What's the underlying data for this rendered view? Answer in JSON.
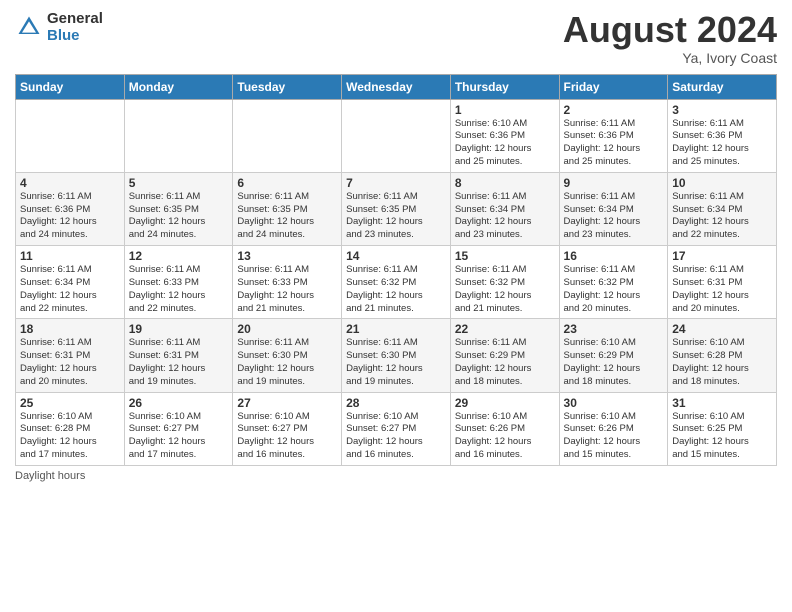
{
  "logo": {
    "general": "General",
    "blue": "Blue"
  },
  "header": {
    "month_year": "August 2024",
    "location": "Ya, Ivory Coast"
  },
  "footer": {
    "note": "Daylight hours"
  },
  "days_of_week": [
    "Sunday",
    "Monday",
    "Tuesday",
    "Wednesday",
    "Thursday",
    "Friday",
    "Saturday"
  ],
  "weeks": [
    {
      "days": [
        {
          "num": "",
          "info": ""
        },
        {
          "num": "",
          "info": ""
        },
        {
          "num": "",
          "info": ""
        },
        {
          "num": "",
          "info": ""
        },
        {
          "num": "1",
          "info": "Sunrise: 6:10 AM\nSunset: 6:36 PM\nDaylight: 12 hours\nand 25 minutes."
        },
        {
          "num": "2",
          "info": "Sunrise: 6:11 AM\nSunset: 6:36 PM\nDaylight: 12 hours\nand 25 minutes."
        },
        {
          "num": "3",
          "info": "Sunrise: 6:11 AM\nSunset: 6:36 PM\nDaylight: 12 hours\nand 25 minutes."
        }
      ]
    },
    {
      "days": [
        {
          "num": "4",
          "info": "Sunrise: 6:11 AM\nSunset: 6:36 PM\nDaylight: 12 hours\nand 24 minutes."
        },
        {
          "num": "5",
          "info": "Sunrise: 6:11 AM\nSunset: 6:35 PM\nDaylight: 12 hours\nand 24 minutes."
        },
        {
          "num": "6",
          "info": "Sunrise: 6:11 AM\nSunset: 6:35 PM\nDaylight: 12 hours\nand 24 minutes."
        },
        {
          "num": "7",
          "info": "Sunrise: 6:11 AM\nSunset: 6:35 PM\nDaylight: 12 hours\nand 23 minutes."
        },
        {
          "num": "8",
          "info": "Sunrise: 6:11 AM\nSunset: 6:34 PM\nDaylight: 12 hours\nand 23 minutes."
        },
        {
          "num": "9",
          "info": "Sunrise: 6:11 AM\nSunset: 6:34 PM\nDaylight: 12 hours\nand 23 minutes."
        },
        {
          "num": "10",
          "info": "Sunrise: 6:11 AM\nSunset: 6:34 PM\nDaylight: 12 hours\nand 22 minutes."
        }
      ]
    },
    {
      "days": [
        {
          "num": "11",
          "info": "Sunrise: 6:11 AM\nSunset: 6:34 PM\nDaylight: 12 hours\nand 22 minutes."
        },
        {
          "num": "12",
          "info": "Sunrise: 6:11 AM\nSunset: 6:33 PM\nDaylight: 12 hours\nand 22 minutes."
        },
        {
          "num": "13",
          "info": "Sunrise: 6:11 AM\nSunset: 6:33 PM\nDaylight: 12 hours\nand 21 minutes."
        },
        {
          "num": "14",
          "info": "Sunrise: 6:11 AM\nSunset: 6:32 PM\nDaylight: 12 hours\nand 21 minutes."
        },
        {
          "num": "15",
          "info": "Sunrise: 6:11 AM\nSunset: 6:32 PM\nDaylight: 12 hours\nand 21 minutes."
        },
        {
          "num": "16",
          "info": "Sunrise: 6:11 AM\nSunset: 6:32 PM\nDaylight: 12 hours\nand 20 minutes."
        },
        {
          "num": "17",
          "info": "Sunrise: 6:11 AM\nSunset: 6:31 PM\nDaylight: 12 hours\nand 20 minutes."
        }
      ]
    },
    {
      "days": [
        {
          "num": "18",
          "info": "Sunrise: 6:11 AM\nSunset: 6:31 PM\nDaylight: 12 hours\nand 20 minutes."
        },
        {
          "num": "19",
          "info": "Sunrise: 6:11 AM\nSunset: 6:31 PM\nDaylight: 12 hours\nand 19 minutes."
        },
        {
          "num": "20",
          "info": "Sunrise: 6:11 AM\nSunset: 6:30 PM\nDaylight: 12 hours\nand 19 minutes."
        },
        {
          "num": "21",
          "info": "Sunrise: 6:11 AM\nSunset: 6:30 PM\nDaylight: 12 hours\nand 19 minutes."
        },
        {
          "num": "22",
          "info": "Sunrise: 6:11 AM\nSunset: 6:29 PM\nDaylight: 12 hours\nand 18 minutes."
        },
        {
          "num": "23",
          "info": "Sunrise: 6:10 AM\nSunset: 6:29 PM\nDaylight: 12 hours\nand 18 minutes."
        },
        {
          "num": "24",
          "info": "Sunrise: 6:10 AM\nSunset: 6:28 PM\nDaylight: 12 hours\nand 18 minutes."
        }
      ]
    },
    {
      "days": [
        {
          "num": "25",
          "info": "Sunrise: 6:10 AM\nSunset: 6:28 PM\nDaylight: 12 hours\nand 17 minutes."
        },
        {
          "num": "26",
          "info": "Sunrise: 6:10 AM\nSunset: 6:27 PM\nDaylight: 12 hours\nand 17 minutes."
        },
        {
          "num": "27",
          "info": "Sunrise: 6:10 AM\nSunset: 6:27 PM\nDaylight: 12 hours\nand 16 minutes."
        },
        {
          "num": "28",
          "info": "Sunrise: 6:10 AM\nSunset: 6:27 PM\nDaylight: 12 hours\nand 16 minutes."
        },
        {
          "num": "29",
          "info": "Sunrise: 6:10 AM\nSunset: 6:26 PM\nDaylight: 12 hours\nand 16 minutes."
        },
        {
          "num": "30",
          "info": "Sunrise: 6:10 AM\nSunset: 6:26 PM\nDaylight: 12 hours\nand 15 minutes."
        },
        {
          "num": "31",
          "info": "Sunrise: 6:10 AM\nSunset: 6:25 PM\nDaylight: 12 hours\nand 15 minutes."
        }
      ]
    }
  ]
}
